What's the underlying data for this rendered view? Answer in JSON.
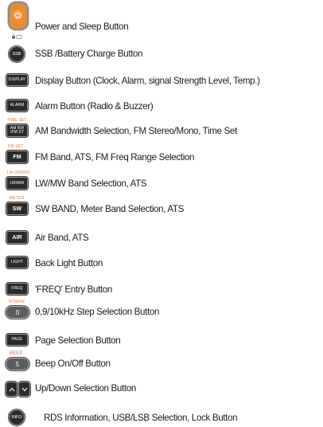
{
  "rows": [
    {
      "key": "",
      "label": "Power and Sleep Button",
      "icon": "power-icon"
    },
    {
      "key": "SSB",
      "label": "SSB /Battery Charge Button"
    },
    {
      "key": "DISPLAY",
      "label": "Display Button (Clock, Alarm, signal Strength Level, Temp.)"
    },
    {
      "key": "ALARM",
      "label": "Alarm Button (Radio & Buzzer)"
    },
    {
      "super": "TIME SET",
      "key_line1": "AM BW",
      "key_line2": "/FM ST",
      "label": "AM Bandwidth Selection, FM Stereo/Mono, Time Set"
    },
    {
      "super": "FM SET",
      "key": "FM",
      "label": "FM Band, ATS, FM Freq Range Selection"
    },
    {
      "super": "LW ON/OFF",
      "key": "LW/MW",
      "label": "LW/MW Band Selection, ATS"
    },
    {
      "super": "METER",
      "key": "SW",
      "label": "SW BAND, Meter Band Selection, ATS"
    },
    {
      "key": "AIR",
      "label": "Air Band, ATS"
    },
    {
      "key": "LIGHT",
      "label": "Back Light Button"
    },
    {
      "key": "FREQ",
      "label": "'FREQ' Entry Button"
    },
    {
      "super": "9/10kHZ",
      "key": "0",
      "label": "0,9/10kHz Step Selection Button"
    },
    {
      "key": "PAGE",
      "label": "Page Selection Button"
    },
    {
      "super": "BEEP",
      "key": "5",
      "label": "Beep On/Off Button"
    },
    {
      "label": "Up/Down Selection Button",
      "icon_up": "chevron-up-icon",
      "icon_down": "chevron-down-icon"
    },
    {
      "key": "INFO",
      "label": "RDS Information, USB/LSB Selection, Lock Button"
    }
  ]
}
